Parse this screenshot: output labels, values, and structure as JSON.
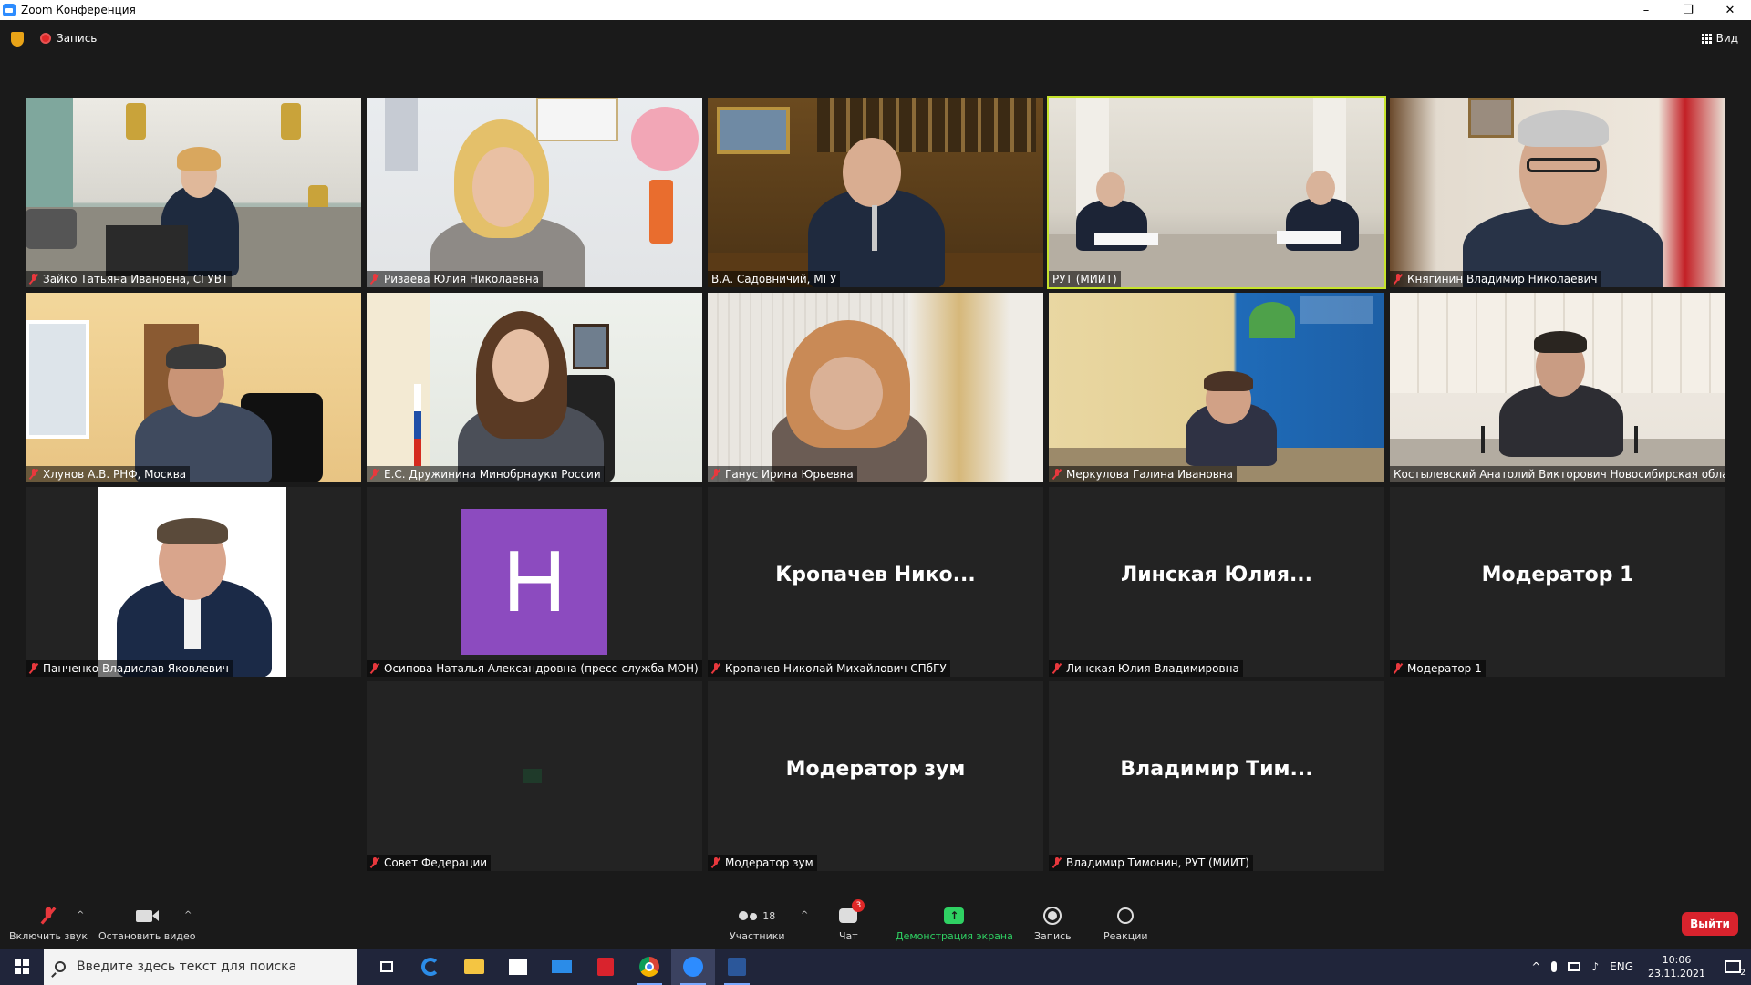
{
  "window": {
    "title": "Zoom Конференция",
    "controls": [
      "–",
      "❐",
      "✕"
    ]
  },
  "topbar": {
    "recording_label": "Запись",
    "view_label": "Вид"
  },
  "tiles": [
    {
      "name": "Зайко Татьяна Ивановна, СГУВТ",
      "muted": true,
      "type": "video"
    },
    {
      "name": "Ризаева Юлия Николаевна",
      "muted": true,
      "type": "video"
    },
    {
      "name": "В.А. Садовничий, МГУ",
      "muted": false,
      "type": "video"
    },
    {
      "name": "РУТ (МИИТ)",
      "muted": false,
      "type": "video",
      "active_speaker": true
    },
    {
      "name": "Княгинин Владимир Николаевич",
      "muted": true,
      "type": "video"
    },
    {
      "name": "Хлунов А.В. РНФ, Москва",
      "muted": true,
      "type": "video"
    },
    {
      "name": "Е.С. Дружинина Минобрнауки России",
      "muted": true,
      "type": "video"
    },
    {
      "name": "Ганус Ирина Юрьевна",
      "muted": true,
      "type": "video"
    },
    {
      "name": "Меркулова Галина Ивановна",
      "muted": true,
      "type": "video"
    },
    {
      "name": "Костылевский Анатолий Викторович Новосибирская обла...",
      "muted": false,
      "type": "video"
    },
    {
      "name": "Панченко Владислав Яковлевич",
      "muted": true,
      "type": "photo"
    },
    {
      "name": "Осипова Наталья Александровна (пресс-служба МОН)",
      "muted": true,
      "type": "avatar",
      "avatar_letter": "H"
    },
    {
      "name": "Кропачев Николай Михайлович СПбГУ",
      "muted": true,
      "type": "text",
      "display_name": "Кропачев  Нико..."
    },
    {
      "name": "Линская Юлия Владимировна",
      "muted": true,
      "type": "text",
      "display_name": "Линская  Юлия..."
    },
    {
      "name": "Модератор 1",
      "muted": true,
      "type": "text",
      "display_name": "Модератор 1"
    },
    {
      "name": "Совет Федерации",
      "muted": true,
      "type": "dark"
    },
    {
      "name": "Модератор зум",
      "muted": true,
      "type": "text",
      "display_name": "Модератор зум"
    },
    {
      "name": "Владимир Тимонин, РУТ (МИИТ)",
      "muted": true,
      "type": "text",
      "display_name": "Владимир  Тим..."
    }
  ],
  "toolbar": {
    "unmute_label": "Включить звук",
    "stop_video_label": "Остановить видео",
    "participants_label": "Участники",
    "participants_count": "18",
    "chat_label": "Чат",
    "chat_badge": "3",
    "share_label": "Демонстрация экрана",
    "record_label": "Запись",
    "reactions_label": "Реакции",
    "leave_label": "Выйти"
  },
  "taskbar": {
    "search_placeholder": "Введите здесь текст для поиска",
    "lang": "ENG",
    "time": "10:06",
    "date": "23.11.2021",
    "notif_count": "2"
  }
}
